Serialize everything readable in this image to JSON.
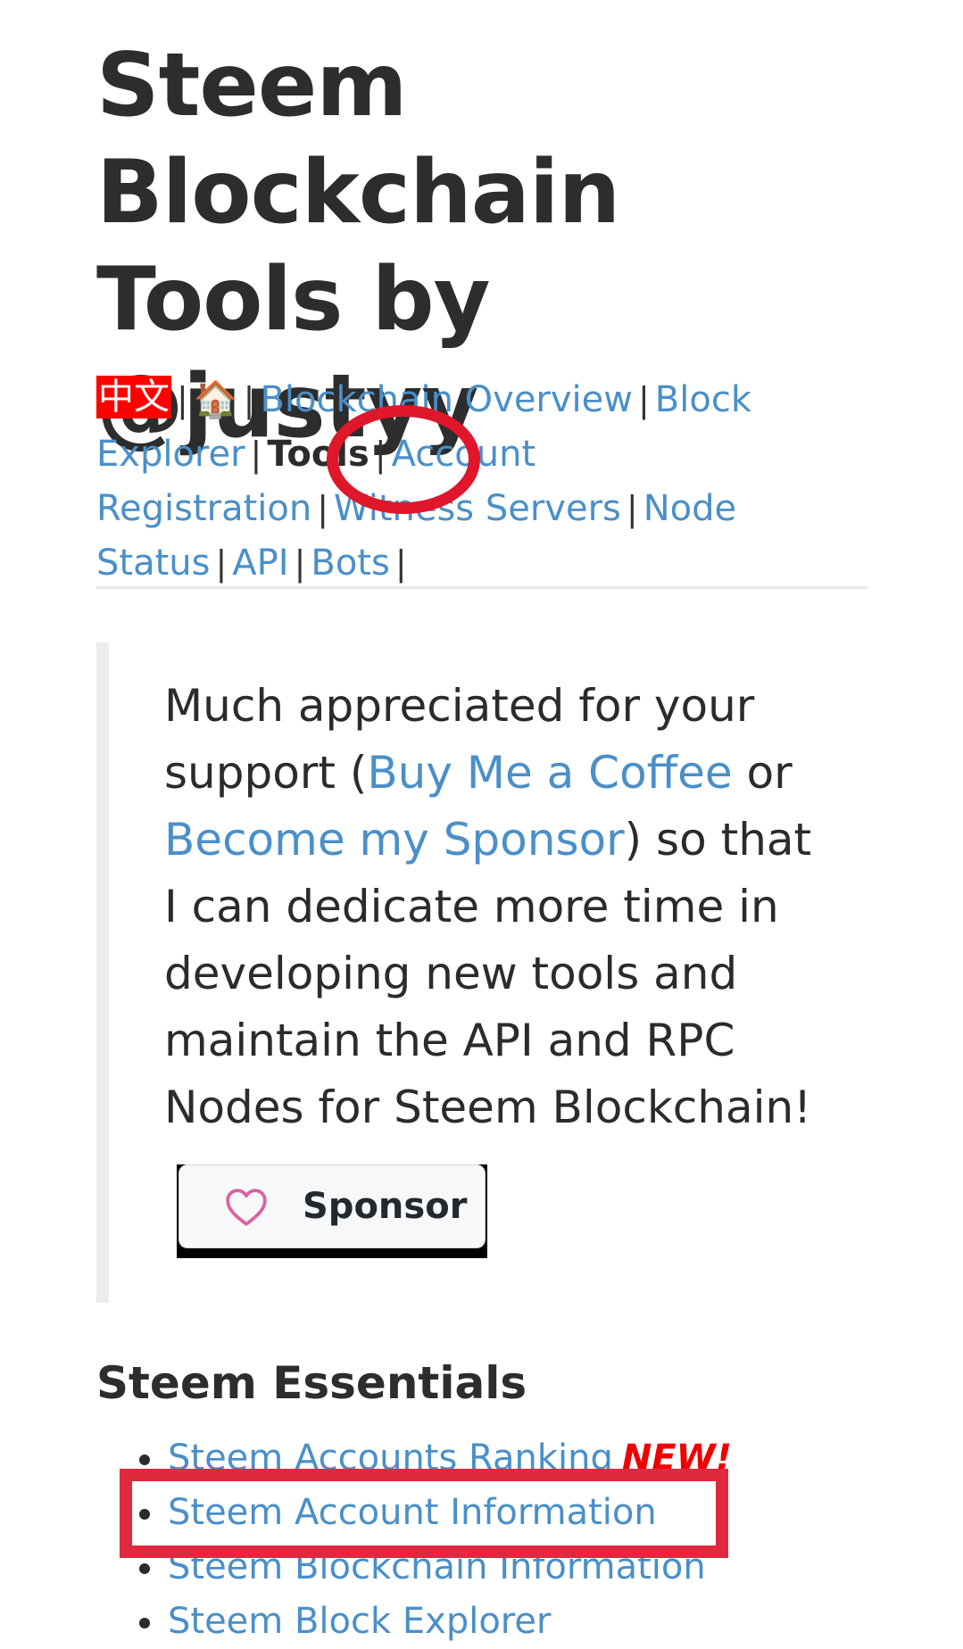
{
  "header": {
    "title": "Steem Blockchain Tools by @justyy"
  },
  "nav": {
    "lang_label": "中文",
    "home_icon": "house-icon",
    "items": [
      {
        "label": "Blockchain Overview"
      },
      {
        "label": "Block Explorer"
      },
      {
        "label": "Tools"
      },
      {
        "label": "Account Registration"
      },
      {
        "label": "Witness Servers"
      },
      {
        "label": "Node Status"
      },
      {
        "label": "API"
      },
      {
        "label": "Bots"
      }
    ],
    "separator": "|"
  },
  "support": {
    "text_1": "Much appreciated for your support (",
    "link_coffee": "Buy Me a Coffee",
    "text_2": " or ",
    "link_sponsor": "Become my Sponsor",
    "text_3": ") so that I can dedicate more time in developing new tools and maintain the API and RPC Nodes for Steem Blockchain!",
    "sponsor_button": "Sponsor",
    "sponsor_icon": "heart-icon"
  },
  "essentials": {
    "heading": "Steem Essentials",
    "items": [
      {
        "label": "Steem Accounts Ranking",
        "badge": "NEW!"
      },
      {
        "label": "Steem Account Information",
        "badge": ""
      },
      {
        "label": "Steem Blockchain Information",
        "badge": ""
      },
      {
        "label": "Steem Block Explorer",
        "badge": ""
      }
    ]
  },
  "colors": {
    "link": "#4a8fc9",
    "annotation_red": "#e0162b",
    "new_badge": "#ee0000"
  }
}
